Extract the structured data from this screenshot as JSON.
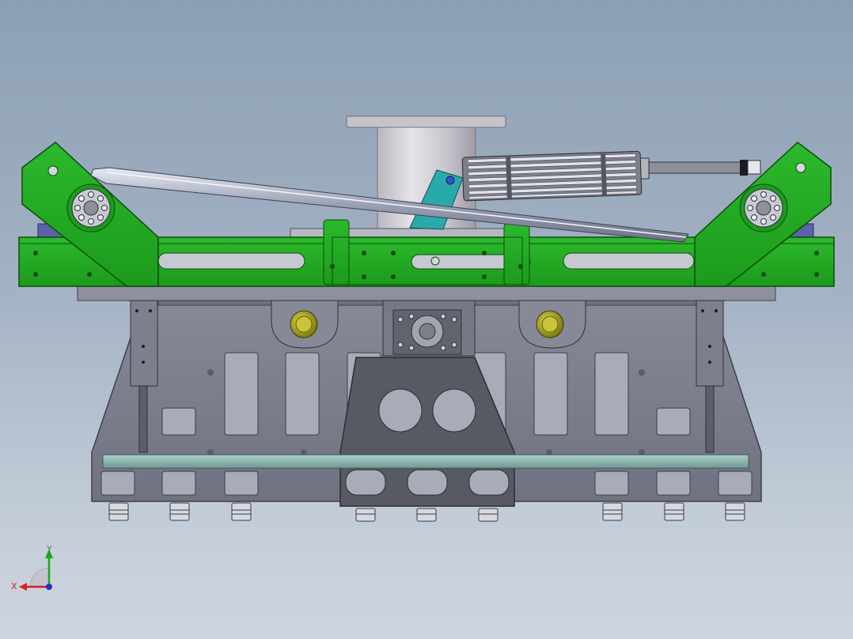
{
  "viewport": {
    "background_top": "#8c9fb4",
    "background_bottom": "#cdd5df"
  },
  "model": {
    "colors": {
      "green_frame": "#22a822",
      "green_dark": "#0e5a0e",
      "steel_plate": "#7c7f8c",
      "steel_dark": "#4a4c57",
      "glass_bar": "#8fb7b0",
      "bearing_yellow": "#a6a11a",
      "cylinder_grey": "#c9c8cf",
      "teal_bracket": "#2aa9aa"
    }
  },
  "triad": {
    "x_label": "X",
    "y_label": "Y",
    "x_color": "#d42020",
    "y_color": "#18a818",
    "z_color": "#2030c8",
    "icon": "coordinate-triad-icon"
  }
}
